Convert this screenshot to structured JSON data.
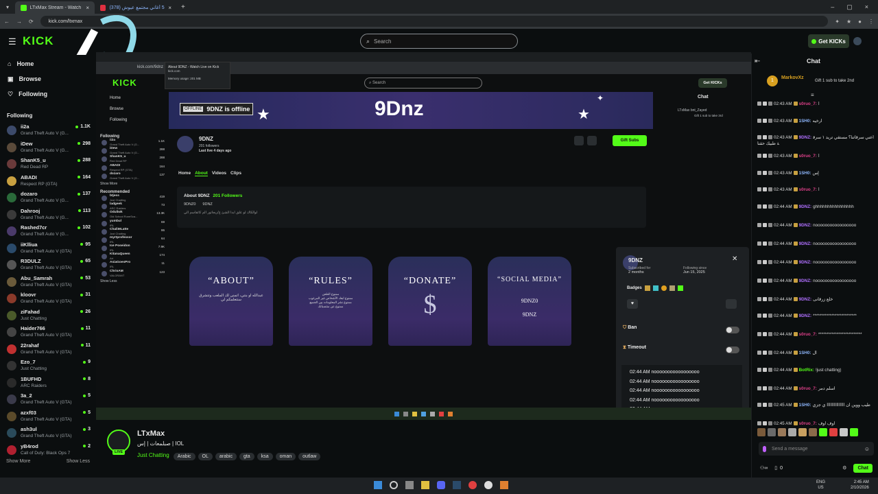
{
  "browser": {
    "tabs": [
      {
        "label": "LTxMax Stream - Watch Live on",
        "active": true
      },
      {
        "label": "(378) أعظم 5 أغاني مجتمع عيوش",
        "active": false
      }
    ],
    "url": "kick.com/ltxmax"
  },
  "topnav": {
    "logo": "KICK",
    "search_placeholder": "Search",
    "get_kicks_label": "Get KICKs"
  },
  "sidebar": {
    "nav": [
      {
        "label": "Home",
        "icon": "home-icon"
      },
      {
        "label": "Browse",
        "icon": "browse-icon"
      },
      {
        "label": "Following",
        "icon": "heart-icon"
      }
    ],
    "following_title": "Following",
    "following": [
      {
        "name": "ii2a",
        "game": "Grand Theft Auto V (G...",
        "viewers": "1.1K",
        "color": "#3c4a6a"
      },
      {
        "name": "iDew",
        "game": "Grand Theft Auto V (G...",
        "viewers": "298",
        "color": "#5a4a3a"
      },
      {
        "name": "ShanK5_u",
        "game": "Red Dead RP",
        "viewers": "288",
        "color": "#6a3a3a"
      },
      {
        "name": "ABADI",
        "game": "Respect RP (GTA)",
        "viewers": "164",
        "color": "#c8a040"
      },
      {
        "name": "dozaro",
        "game": "Grand Theft Auto V (G...",
        "viewers": "137",
        "color": "#2a6a3a"
      },
      {
        "name": "Dahrooj",
        "game": "Grand Theft Auto V (G...",
        "viewers": "113",
        "color": "#3a3a3a"
      },
      {
        "name": "Rashed7cr",
        "game": "Grand Theft Auto V (G...",
        "viewers": "102",
        "color": "#4a3a6a"
      },
      {
        "name": "iiKlliua",
        "game": "Grand Theft Auto V (GTA)",
        "viewers": "95",
        "color": "#2a4a6a"
      },
      {
        "name": "R3DULZ",
        "game": "Grand Theft Auto V (GTA)",
        "viewers": "65",
        "color": "#555"
      },
      {
        "name": "Abu_Samrah",
        "game": "Grand Theft Auto V (GTA)",
        "viewers": "53",
        "color": "#6a5a3a"
      },
      {
        "name": "kloovr",
        "game": "Grand Theft Auto V (GTA)",
        "viewers": "31",
        "color": "#8a3a2a"
      },
      {
        "name": "ziFahad",
        "game": "Just Chatting",
        "viewers": "26",
        "color": "#4a5a2a"
      },
      {
        "name": "Haider766",
        "game": "Grand Theft Auto V (GTA)",
        "viewers": "11",
        "color": "#444"
      },
      {
        "name": "22rahaf",
        "game": "Grand Theft Auto V (GTA)",
        "viewers": "11",
        "color": "#c03030"
      },
      {
        "name": "Ezo_7",
        "game": "Just Chatting",
        "viewers": "9",
        "color": "#333"
      },
      {
        "name": "1BUFHD",
        "game": "ARC Raiders",
        "viewers": "8",
        "color": "#2a2a2a"
      },
      {
        "name": "3a_2",
        "game": "Grand Theft Auto V (GTA)",
        "viewers": "5",
        "color": "#3a3a4a"
      },
      {
        "name": "azxf03",
        "game": "Grand Theft Auto V (GTA)",
        "viewers": "5",
        "color": "#5a4a2a"
      },
      {
        "name": "ash3ul",
        "game": "Grand Theft Auto V (GTA)",
        "viewers": "3",
        "color": "#2a4a5a"
      },
      {
        "name": "yB4rod",
        "game": "Call of Duty: Black Ops 7",
        "viewers": "2",
        "color": "#b02030"
      }
    ],
    "show_more": "Show More",
    "show_less": "Show Less"
  },
  "inner": {
    "url": "kick.com/9dnz",
    "popup_title": "About 9DNZ - Watch Live on Kick",
    "popup_sub": "kick.com",
    "memory": "Memory usage: 201 MB",
    "search": "Search",
    "get_kicks": "Get KICKs",
    "nav": [
      "Home",
      "Browse",
      "Following"
    ],
    "following_title": "Following",
    "following": [
      {
        "name": "ii2a",
        "game": "Grand Theft Auto V (G...",
        "v": "1.1K"
      },
      {
        "name": "iDew",
        "game": "Grand Theft Auto V (G...",
        "v": "288"
      },
      {
        "name": "ShanK5_u",
        "game": "Red Dead RP",
        "v": "288"
      },
      {
        "name": "ABADI",
        "game": "Respect RP (GTA)",
        "v": "164"
      },
      {
        "name": "dozaro",
        "game": "Grand Theft Auto V (G...",
        "v": "137"
      }
    ],
    "show_more": "Show More",
    "recommended_title": "Recommended",
    "recommended": [
      {
        "name": "btjess",
        "game": "Just Chatting",
        "v": "419"
      },
      {
        "name": "ladgeek",
        "game": "ARC Raiders",
        "v": "73"
      },
      {
        "name": "Oduliwk",
        "game": "Old School RuneSca...",
        "v": "13.3K"
      },
      {
        "name": "yumbul",
        "game": "IRL",
        "v": "69"
      },
      {
        "name": "ChaliMLatte",
        "game": "Just Chatting",
        "v": "86"
      },
      {
        "name": "myrtprofessor",
        "game": "IRL",
        "v": "64"
      },
      {
        "name": "Ice Poseidon",
        "game": "IRL",
        "v": "7.9K"
      },
      {
        "name": "KitanaQueen",
        "game": "Art",
        "v": "174"
      },
      {
        "name": "AsiaGoesPro",
        "game": "IRL",
        "v": "11"
      },
      {
        "name": "ChrisAM",
        "game": "VALORANT",
        "v": "123"
      }
    ],
    "show_less": "Show Less",
    "banner_offline_badge": "OFFLINE",
    "banner_offline_text": "9DNZ is offline",
    "banner_logo": "9Dnz",
    "channel_name": "9DNZ",
    "channel_followers": "201 followers",
    "channel_lastlive": "Last live 4 days ago",
    "gift_subs": "Gift Subs",
    "tabs": [
      "Home",
      "About",
      "Videos",
      "Clips"
    ],
    "about_title": "About 9DNZ",
    "about_followers": "201 Followers",
    "about_social": [
      "9DNZ0",
      "9DNZ"
    ],
    "about_desc": "لوالكاك لو علق ابدا الشئ ع/ريجاتور الم كاتقاسم الي",
    "cards": [
      {
        "title": "“ABOUT”",
        "text": "عبدالله او بنتي، اتمنى لك الملعب وتتشرق ستتعلمكم لي"
      },
      {
        "title": "“RULES”",
        "text": "ممنوع الطعن\nممنوع ابعاد الأشخاص غير المرغوب\nممنوع نشر المعلومات بين الجميع\nممنوع عن منتسباتك"
      },
      {
        "title": "“DONATE”",
        "text": "$"
      },
      {
        "title": "“SOCIAL MEDIA”",
        "text": "9DNZ0\n9DNZ"
      }
    ],
    "chat_title": "Chat",
    "chat_user": "LTxMax",
    "chat_user2": "bnt_Zayed",
    "chat_gift": "Gift 1 sub to take 3rd",
    "mod_card": {
      "name": "9DNZ",
      "subscribed_label": "Subscribed for",
      "subscribed_value": "2 months",
      "following_label": "Following since",
      "following_value": "Jun 15, 2025",
      "badges_label": "Badges",
      "ban_label": "Ban",
      "timeout_label": "Timeout",
      "messages": [
        "02:44 AM nooooooooooooooooo",
        "02:44 AM nooooooooooooooooo",
        "02:44 AM nooooooooooooooooo",
        "02:44 AM nooooooooooooooooo",
        "02:44 AM nooooooooooooooooo",
        "02:44 AM nooooooooooooooooo",
        "02:44 AM nooooooooooooooooo",
        "02:44 AM nooooooooooooooooo",
        "02:44 AM nooooooooooooooooo",
        "02:44 AM nooooooooooooooooo"
      ]
    }
  },
  "stream": {
    "name": "LTxMax",
    "live_badge": "LIVE",
    "title": "صبلمعات | إس | IOL",
    "category": "Just Chatting",
    "tags": [
      "Arabic",
      "OL",
      "arabic",
      "gta",
      "ksa",
      "oman",
      "outlaw"
    ]
  },
  "chat": {
    "title": "Chat",
    "pinned_user": "MarkovXz",
    "pinned_badge": "1",
    "pinned_text": "Gift 1 sub to take 2nd",
    "messages": [
      {
        "time": "02:43 AM",
        "user": "s0ruo_7:",
        "ucolor": "#e0408a",
        "text": "ا"
      },
      {
        "time": "02:43 AM",
        "user": "1SH0:",
        "ucolor": "#8fb8ff",
        "text": "ارخيه"
      },
      {
        "time": "02:43 AM",
        "user": "9DNZ:",
        "ucolor": "#b070ff",
        "text": "اعني سرقاتنا؟ مستقي تريد ١ سرقة طبيك حقنا"
      },
      {
        "time": "02:43 AM",
        "user": "s0ruo_7:",
        "ucolor": "#e0408a",
        "text": "ا"
      },
      {
        "time": "02:43 AM",
        "user": "1SH0:",
        "ucolor": "#8fb8ff",
        "text": "إس"
      },
      {
        "time": "02:43 AM",
        "user": "s0ruo_7:",
        "ucolor": "#e0408a",
        "text": "ا"
      },
      {
        "time": "02:44 AM",
        "user": "9DNZ:",
        "ucolor": "#b070ff",
        "text": "ghhhhhhhhhhhhhhhh"
      },
      {
        "time": "02:44 AM",
        "user": "9DNZ:",
        "ucolor": "#b070ff",
        "text": "nooooooooooooooooo"
      },
      {
        "time": "02:44 AM",
        "user": "9DNZ:",
        "ucolor": "#b070ff",
        "text": "nooooooooooooooooo"
      },
      {
        "time": "02:44 AM",
        "user": "9DNZ:",
        "ucolor": "#b070ff",
        "text": "nooooooooooooooooo"
      },
      {
        "time": "02:44 AM",
        "user": "9DNZ:",
        "ucolor": "#b070ff",
        "text": "nooooooooooooooooo"
      },
      {
        "time": "02:44 AM",
        "user": "9DNZ:",
        "ucolor": "#b070ff",
        "text": "خلع زرقانی"
      },
      {
        "time": "02:44 AM",
        "user": "9DNZ:",
        "ucolor": "#b070ff",
        "text": "**************************"
      },
      {
        "time": "02:44 AM",
        "user": "s0ruo_7:",
        "ucolor": "#e0408a",
        "text": "**************************"
      },
      {
        "time": "02:44 AM",
        "user": "1SH0:",
        "ucolor": "#8fb8ff",
        "text": "ال"
      },
      {
        "time": "02:44 AM",
        "user": "BotRix:",
        "ucolor": "#53fc18",
        "text": "!just chatting)"
      },
      {
        "time": "02:44 AM",
        "user": "s0ruo_7:",
        "ucolor": "#e0408a",
        "text": "اسلم دمر"
      },
      {
        "time": "02:45 AM",
        "user": "1SH0:",
        "ucolor": "#8fb8ff",
        "text": "طيب ووين ان ااااااااااااااا ي جزي"
      },
      {
        "time": "02:45 AM",
        "user": "s0ruo_7:",
        "ucolor": "#e0408a",
        "text": "اوف اوف"
      }
    ],
    "input_placeholder": "Send a message",
    "count": "0",
    "chat_button": "Chat"
  },
  "taskbar": {
    "lang": "ENG",
    "region": "US",
    "time": "2:45 AM",
    "date": "2/10/2026"
  },
  "colors": {
    "kick_green": "#53fc18",
    "bg": "#0b0e0f",
    "purple": "#3b2c68"
  }
}
